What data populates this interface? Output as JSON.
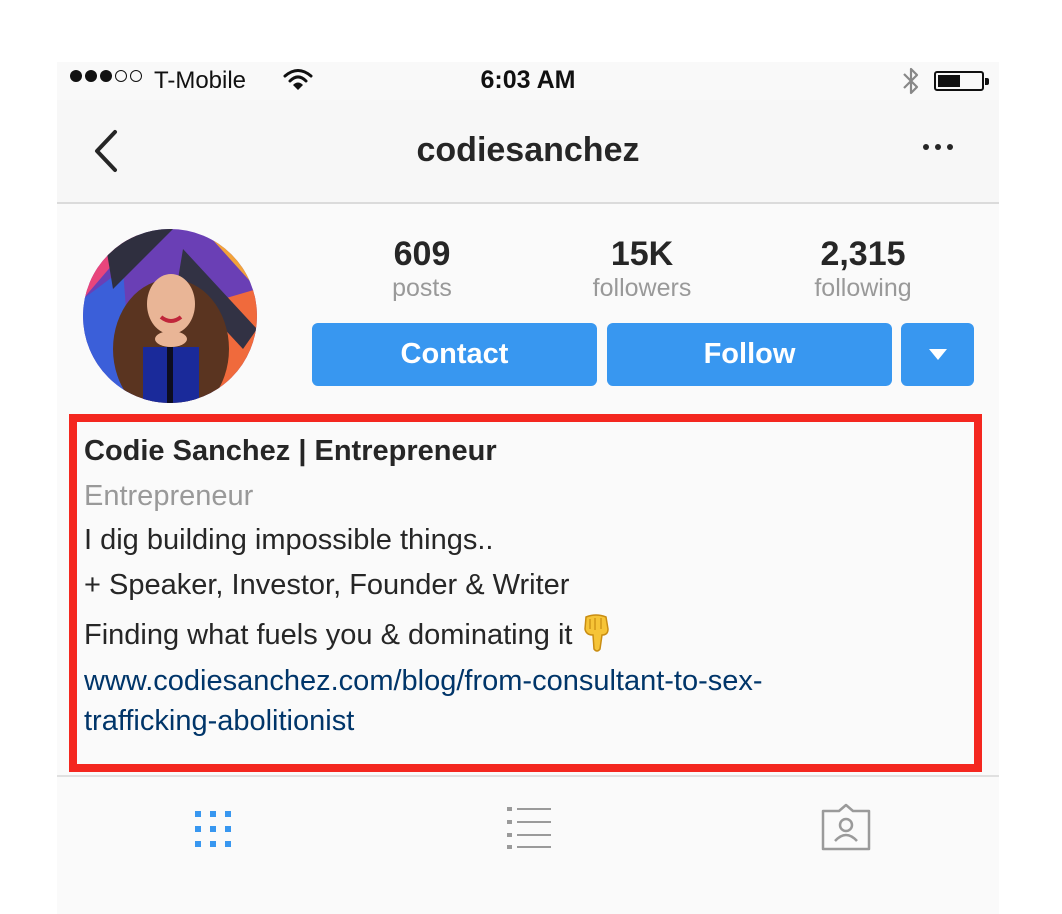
{
  "status_bar": {
    "carrier": "T-Mobile",
    "time": "6:03 AM",
    "signal_bars_filled": 3,
    "signal_bars_total": 5,
    "battery_level": 0.45
  },
  "nav": {
    "title": "codiesanchez",
    "back_icon": "chevron-left-icon",
    "more_icon": "ellipsis-icon"
  },
  "profile": {
    "stats": [
      {
        "value": "609",
        "label": "posts"
      },
      {
        "value": "15K",
        "label": "followers"
      },
      {
        "value": "2,315",
        "label": "following"
      }
    ],
    "buttons": {
      "contact": "Contact",
      "follow": "Follow"
    },
    "accent_color": "#3897f0"
  },
  "bio": {
    "name": "Codie Sanchez | Entrepreneur",
    "category": "Entrepreneur",
    "lines": [
      "I dig building impossible things..",
      "+ Speaker, Investor, Founder & Writer",
      "Finding what fuels you & dominating it"
    ],
    "link_line1": "www.codiesanchez.com/blog/from-consultant-to-sex-",
    "link_line2": "trafficking-abolitionist",
    "highlight_color": "#f4271f"
  },
  "tabs": [
    {
      "icon": "grid-icon",
      "active": true
    },
    {
      "icon": "list-icon",
      "active": false
    },
    {
      "icon": "tagged-user-icon",
      "active": false
    }
  ]
}
